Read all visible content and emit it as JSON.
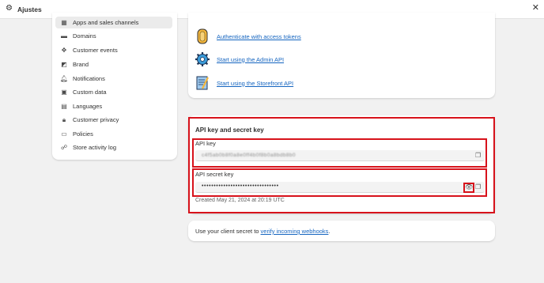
{
  "window": {
    "title": "Ajustes"
  },
  "sidebar": {
    "items": [
      {
        "label": "Apps and sales channels",
        "icon": "apps-icon"
      },
      {
        "label": "Domains",
        "icon": "globe-icon"
      },
      {
        "label": "Customer events",
        "icon": "pixel-icon"
      },
      {
        "label": "Brand",
        "icon": "brand-icon"
      },
      {
        "label": "Notifications",
        "icon": "bell-icon"
      },
      {
        "label": "Custom data",
        "icon": "database-icon"
      },
      {
        "label": "Languages",
        "icon": "language-icon"
      },
      {
        "label": "Customer privacy",
        "icon": "lock-icon"
      },
      {
        "label": "Policies",
        "icon": "document-icon"
      },
      {
        "label": "Store activity log",
        "icon": "activity-icon"
      }
    ]
  },
  "links": [
    {
      "label": "Authenticate with access tokens",
      "icon": "token-icon"
    },
    {
      "label": "Start using the Admin API",
      "icon": "gear-cog-icon"
    },
    {
      "label": "Start using the Storefront API",
      "icon": "storefront-icon"
    }
  ],
  "api": {
    "title": "API key and secret key",
    "key_label": "API key",
    "key_value": "c4f5ab0b8f0a8e0ff4b0f8b0a8bdb8b0",
    "secret_label": "API secret key",
    "secret_value": "••••••••••••••••••••••••••••••••",
    "created": "Created May 21, 2024 at 20:19 UTC"
  },
  "footer": {
    "prefix": "Use your client secret to ",
    "link": "verify incoming webhooks",
    "suffix": "."
  },
  "colors": {
    "highlight": "#d7121b",
    "link": "#1565c0"
  }
}
